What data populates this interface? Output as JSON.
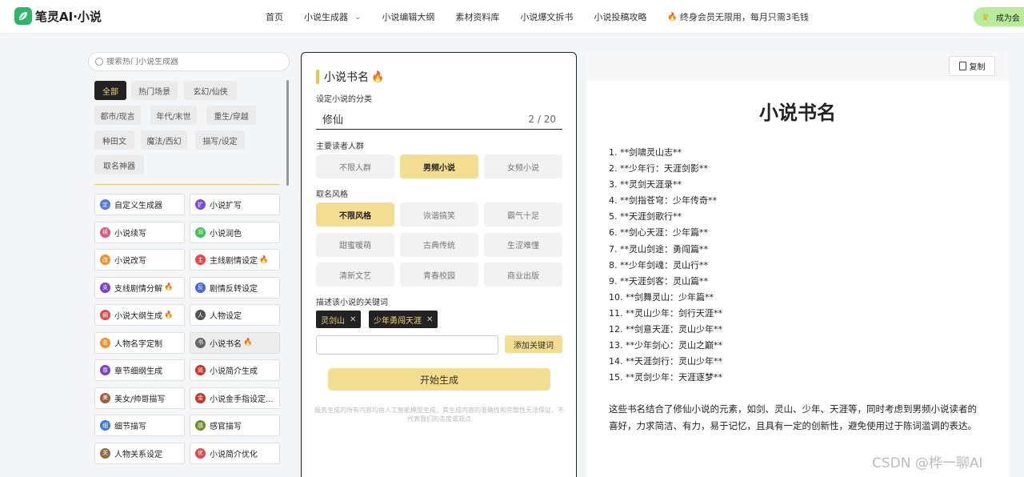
{
  "header": {
    "logo_text": "笔灵AI·小说",
    "nav": [
      {
        "label": "首页"
      },
      {
        "label": "小说生成器",
        "has_dropdown": true
      },
      {
        "label": "小说编辑大纲"
      },
      {
        "label": "素材资料库"
      },
      {
        "label": "小说爆文拆书"
      },
      {
        "label": "小说投稿攻略"
      }
    ],
    "promo": "终身会员无限用，每月只需3毛钱",
    "vip_button": "成为会"
  },
  "sidebar": {
    "search_placeholder": "搜索热门小说生成器",
    "categories": [
      {
        "label": "全部",
        "active": true
      },
      {
        "label": "热门场景"
      },
      {
        "label": "玄幻/仙侠"
      },
      {
        "label": "都市/现言"
      },
      {
        "label": "年代/末世"
      },
      {
        "label": "重生/穿越"
      },
      {
        "label": "种田文"
      },
      {
        "label": "魔法/西幻"
      },
      {
        "label": "描写/设定"
      },
      {
        "label": "取名神器"
      }
    ],
    "tools": [
      {
        "label": "自定义生成器",
        "icon": "定",
        "color": "#4a78e6"
      },
      {
        "label": "小说扩写",
        "icon": "扩",
        "color": "#7b4be6"
      },
      {
        "label": "小说续写",
        "icon": "续",
        "color": "#e6507a"
      },
      {
        "label": "小说润色",
        "icon": "润",
        "color": "#3fbf5a"
      },
      {
        "label": "小说改写",
        "icon": "改",
        "color": "#f0922a"
      },
      {
        "label": "主线剧情设定",
        "icon": "主",
        "color": "#e04848",
        "hot": true
      },
      {
        "label": "支线剧情分解",
        "icon": "支",
        "color": "#7b3fd0",
        "hot": true
      },
      {
        "label": "剧情反转设定",
        "icon": "反",
        "color": "#4466dd"
      },
      {
        "label": "小说大纲生成",
        "icon": "纲",
        "color": "#e04848",
        "hot": true
      },
      {
        "label": "人物设定",
        "icon": "人",
        "color": "#555555"
      },
      {
        "label": "人物名字定制",
        "icon": "名",
        "color": "#f0922a"
      },
      {
        "label": "小说书名",
        "icon": "书",
        "color": "#666666",
        "hot": true,
        "highlight": true
      },
      {
        "label": "章节细纲生成",
        "icon": "章",
        "color": "#7b3fd0"
      },
      {
        "label": "小说简介生成",
        "icon": "简",
        "color": "#c0392b"
      },
      {
        "label": "美女/帅哥描写",
        "icon": "美",
        "color": "#a05a3a"
      },
      {
        "label": "小说金手指设定...",
        "icon": "金",
        "color": "#c0392b"
      },
      {
        "label": "细节描写",
        "icon": "细",
        "color": "#3a7bd5"
      },
      {
        "label": "感官描写",
        "icon": "感",
        "color": "#6b8e23"
      },
      {
        "label": "人物关系设定",
        "icon": "关",
        "color": "#8b6b4a"
      },
      {
        "label": "小说简介优化",
        "icon": "优",
        "color": "#e04848"
      }
    ]
  },
  "form": {
    "title": "小说书名",
    "category_label": "设定小说的分类",
    "category_value": "修仙",
    "category_count": "2 / 20",
    "audience_label": "主要读者人群",
    "audience_options": [
      {
        "label": "不限人群"
      },
      {
        "label": "男频小说",
        "selected": true
      },
      {
        "label": "女频小说"
      }
    ],
    "style_label": "取名风格",
    "style_options": [
      {
        "label": "不限风格",
        "selected": true
      },
      {
        "label": "诙谐搞笑"
      },
      {
        "label": "霸气十足"
      },
      {
        "label": "甜蜜暖萌"
      },
      {
        "label": "古典传统"
      },
      {
        "label": "生涩难懂"
      },
      {
        "label": "清新文艺"
      },
      {
        "label": "青春校园"
      },
      {
        "label": "商业出版"
      }
    ],
    "keywords_label": "描述该小说的关键词",
    "keywords": [
      "灵剑山",
      "少年勇闯天涯"
    ],
    "keyword_input_value": "",
    "add_keyword_label": "添加关键词",
    "generate_label": "开始生成",
    "disclaimer": "服务生成的所有内容均由人工智能模型生成，其生成内容的准确性和完整性无法保证，不代表我们的态度或观点"
  },
  "result": {
    "copy_label": "复制",
    "title": "小说书名",
    "items": [
      "1. **剑啸灵山志**",
      "2. **少年行：天涯剑影**",
      "3. **灵剑天涯录**",
      "4. **剑指苍穹：少年传奇**",
      "5. **天涯剑歌行**",
      "6. **剑心天涯：少年篇**",
      "7. **灵山剑途：勇闯篇**",
      "8. **少年剑魂：灵山行**",
      "9. **天涯剑客：灵山篇**",
      "10. **剑舞灵山：少年篇**",
      "11. **灵山少年：剑行天涯**",
      "12. **剑意天涯：灵山少年**",
      "13. **少年剑心：灵山之巅**",
      "14. **天涯剑行：灵山少年**",
      "15. **灵剑少年：天涯逐梦**"
    ],
    "summary": "这些书名结合了修仙小说的元素，如剑、灵山、少年、天涯等，同时考虑到男频小说读者的喜好，力求简洁、有力，易于记忆，且具有一定的创新性，避免使用过于陈词滥调的表达。"
  },
  "watermark": "CSDN @桦一聊AI",
  "colors": {
    "accent_gold": "#f3dd90",
    "dark": "#222222",
    "brand_green": "#2fb56a",
    "vip_green": "#b9ec9a",
    "hot": "#f08a1c"
  }
}
